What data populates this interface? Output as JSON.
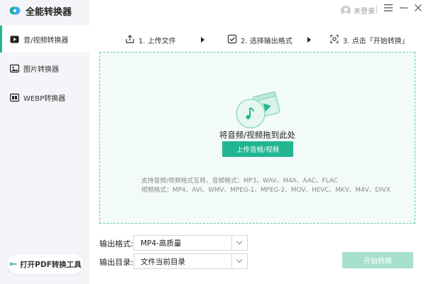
{
  "app": {
    "title": "全能转换器"
  },
  "sidebar": {
    "items": [
      {
        "label": "音/视频转换器",
        "icon": "video-play-icon",
        "active": true
      },
      {
        "label": "图片转换器",
        "icon": "image-icon",
        "active": false
      },
      {
        "label": "WEBP转换器",
        "icon": "webp-icon",
        "active": false
      }
    ],
    "pdf_tool_label": "打开PDF转换工具"
  },
  "titlebar": {
    "login_label": "未登录",
    "menu_icon": "hamburger-menu-icon",
    "minimize_icon": "minimize-icon",
    "close_icon": "close-icon"
  },
  "steps": [
    {
      "label": "1. 上传文件",
      "icon": "upload-icon"
    },
    {
      "label": "2. 选择输出格式",
      "icon": "checkbox-icon"
    },
    {
      "label": "3. 点击「开始转换」",
      "icon": "convert-icon"
    }
  ],
  "dropzone": {
    "prompt": "将音频/视频拖到此处",
    "upload_button": "上传音频/视频",
    "formats_line1": "支持音频/视频格式互转、音频格式：MP3、WAV、M4A、AAC、FLAC",
    "formats_line2": "视频格式：MP4、AVI、WMV、MPEG-1、MPEG-2、MOV、HEVC、MKV、M4V、DIVX"
  },
  "output": {
    "format_label": "输出格式:",
    "format_value": "MP4-高质量",
    "dir_label": "输出目录:",
    "dir_value": "文件当前目录",
    "start_button": "开始转换"
  },
  "colors": {
    "accent": "#21b591",
    "accent_disabled": "#a7e0cf",
    "sidebar_bg": "#f4f5f8",
    "dropzone_bg": "#f3fbf8"
  }
}
